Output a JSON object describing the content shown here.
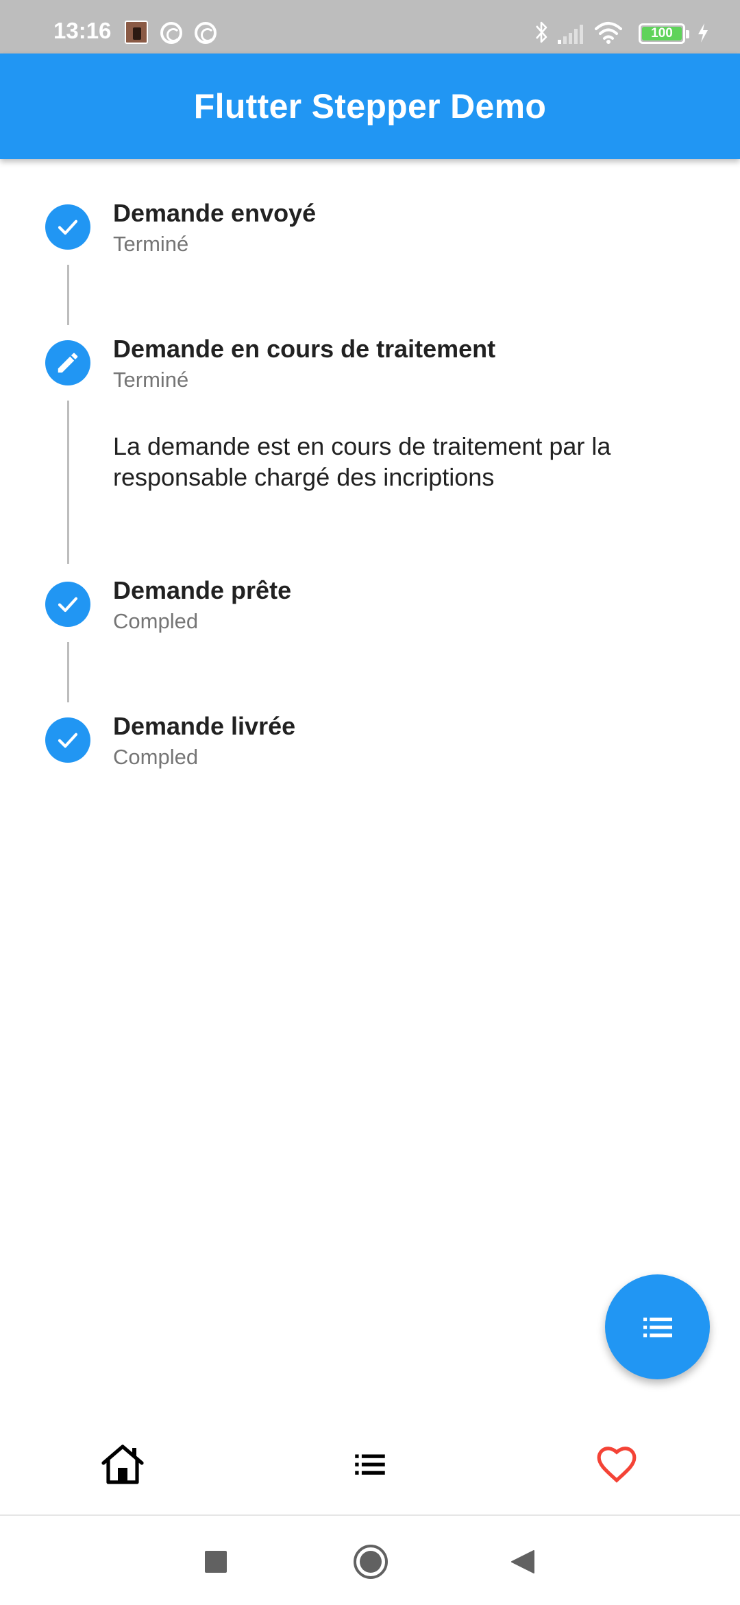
{
  "status_bar": {
    "time": "13:16",
    "battery_level": "100",
    "icons": [
      "photo-thumbnail",
      "sync-icon",
      "sync-icon",
      "bluetooth-icon",
      "signal-icon",
      "wifi-icon",
      "battery-icon",
      "charging-icon"
    ]
  },
  "app_bar": {
    "title": "Flutter Stepper Demo",
    "color": "#2196f3"
  },
  "stepper": {
    "steps": [
      {
        "title": "Demande envoyé",
        "subtitle": "Terminé",
        "icon": "check-icon",
        "state": "complete"
      },
      {
        "title": "Demande en cours de traitement",
        "subtitle": "Terminé",
        "icon": "edit-icon",
        "state": "editing",
        "content": "La demande est en cours de traitement par la responsable chargé des incriptions"
      },
      {
        "title": "Demande prête",
        "subtitle": "Compled",
        "icon": "check-icon",
        "state": "complete"
      },
      {
        "title": "Demande livrée",
        "subtitle": "Compled",
        "icon": "check-icon",
        "state": "complete"
      }
    ]
  },
  "fab": {
    "icon": "list-icon",
    "color": "#2196f3"
  },
  "bottom_nav": {
    "items": [
      {
        "icon": "home-icon",
        "color": "#000000"
      },
      {
        "icon": "list-icon",
        "color": "#000000"
      },
      {
        "icon": "heart-icon",
        "color": "#f44336"
      }
    ]
  },
  "system_nav": {
    "items": [
      "recents-button",
      "home-button",
      "back-button"
    ]
  }
}
